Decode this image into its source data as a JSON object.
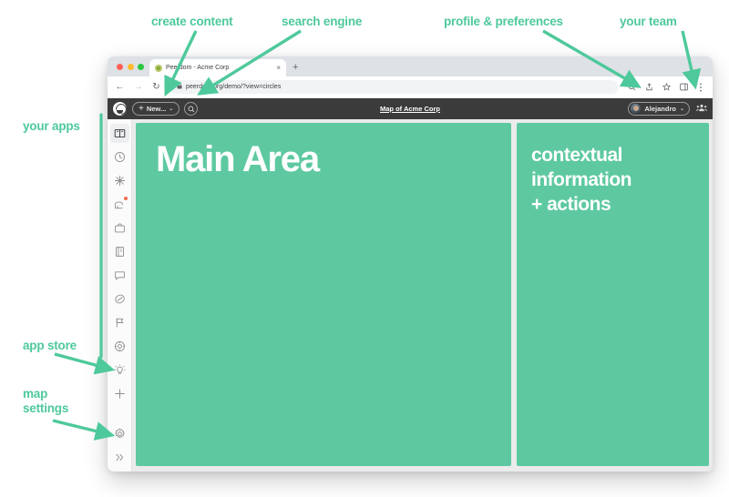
{
  "annotations": [
    {
      "id": "create-content",
      "text": "create content"
    },
    {
      "id": "search-engine",
      "text": "search engine"
    },
    {
      "id": "profile-preferences",
      "text": "profile & preferences"
    },
    {
      "id": "your-team",
      "text": "your team"
    },
    {
      "id": "your-apps",
      "text": "your apps"
    },
    {
      "id": "app-store",
      "text": "app store"
    },
    {
      "id": "map-settings",
      "text": "map\nsettings"
    }
  ],
  "annotation_color": "#4ec99b",
  "browser": {
    "tab": {
      "title": "Peerdom - Acme Corp",
      "favicon": "peerdom-favicon",
      "close": "×"
    },
    "new_tab": "+",
    "nav": {
      "back": "←",
      "forward": "→",
      "reload": "↻"
    },
    "omnibox": {
      "lock": "🔒",
      "url": "peerdom.org/demo/?view=circles"
    },
    "toolbar_icons": [
      "search-icon",
      "share-icon",
      "bookmark-star-icon",
      "sidebar-panel-icon",
      "overflow-menu-icon"
    ]
  },
  "app": {
    "logo": "peerdom-logo",
    "new_button": {
      "label": "New...",
      "plus": "+",
      "chevron": "⌄"
    },
    "search_button": "search-icon",
    "title": "Map of Acme Corp",
    "user": {
      "name": "Alejandro",
      "chevron": "⌄",
      "avatar": "user-avatar"
    },
    "team_icon": "team-people-icon"
  },
  "sidebar": {
    "items": [
      {
        "id": "map",
        "name": "map-icon",
        "active": true,
        "badge": false
      },
      {
        "id": "history",
        "name": "clock-icon",
        "active": false,
        "badge": false
      },
      {
        "id": "highlights",
        "name": "sparkle-icon",
        "active": false,
        "badge": false
      },
      {
        "id": "inbox",
        "name": "mailbox-icon",
        "active": false,
        "badge": true
      },
      {
        "id": "projects",
        "name": "briefcase-icon",
        "active": false,
        "badge": false
      },
      {
        "id": "handbook",
        "name": "book-icon",
        "active": false,
        "badge": false
      },
      {
        "id": "messages",
        "name": "chat-bubble-icon",
        "active": false,
        "badge": false
      },
      {
        "id": "tags",
        "name": "tag-icon",
        "active": false,
        "badge": false
      },
      {
        "id": "flags",
        "name": "flag-icon",
        "active": false,
        "badge": false
      },
      {
        "id": "focus",
        "name": "target-icon",
        "active": false,
        "badge": false
      },
      {
        "id": "ideas",
        "name": "lightbulb-icon",
        "active": false,
        "badge": false
      },
      {
        "id": "app-store",
        "name": "plus-icon",
        "active": false,
        "badge": false
      }
    ],
    "bottom_items": [
      {
        "id": "settings",
        "name": "gear-icon"
      },
      {
        "id": "expand",
        "name": "chevron-double-right-icon"
      }
    ]
  },
  "main": {
    "panel_title": "Main Area",
    "panel_context": "contextual\ninformation\n+ actions",
    "panel_color": "#5ec9a0"
  }
}
